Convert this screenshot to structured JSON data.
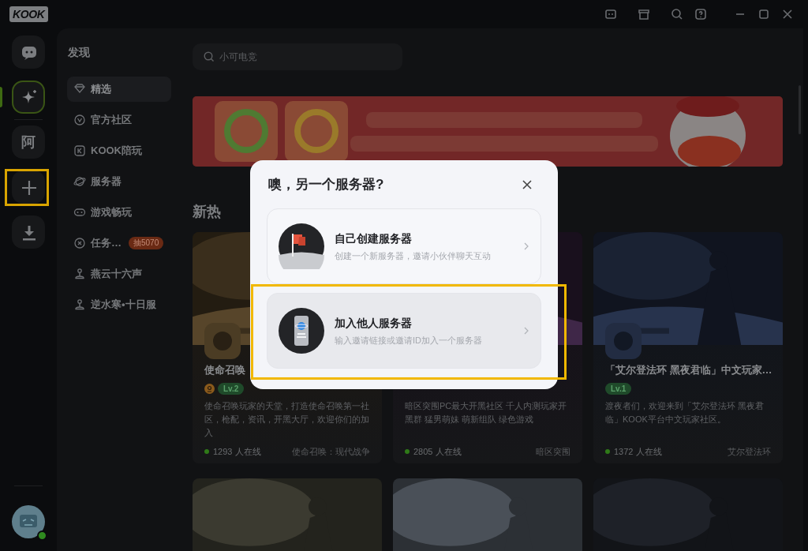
{
  "app": {
    "logo": "KOOK"
  },
  "rail": [
    {
      "kind": "dm",
      "selected": false,
      "highlighted": false
    },
    {
      "kind": "discover",
      "selected": true,
      "highlighted": false
    },
    {
      "kind": "server",
      "label": "阿",
      "selected": false,
      "highlighted": false
    },
    {
      "kind": "add",
      "selected": false,
      "highlighted": true
    },
    {
      "kind": "download",
      "selected": false,
      "highlighted": false
    }
  ],
  "user": {
    "online": true
  },
  "discover": {
    "title": "发现",
    "items": [
      {
        "label": "精选",
        "selected": true
      },
      {
        "label": "官方社区",
        "selected": false
      },
      {
        "label": "KOOK陪玩",
        "selected": false
      },
      {
        "label": "服务器",
        "selected": false
      },
      {
        "label": "游戏畅玩",
        "selected": false
      },
      {
        "label": "任务…",
        "selected": false,
        "badge": "抽5070"
      },
      {
        "label": "燕云十六声",
        "selected": false
      },
      {
        "label": "逆水寒•十日服",
        "selected": false
      }
    ]
  },
  "search": {
    "placeholder": "小可电竞"
  },
  "section": {
    "title": "新热"
  },
  "cards": [
    {
      "title": "使命召唤",
      "owner_badge": true,
      "level": "Lv.2",
      "description": "使命召唤玩家的天堂，打造使命召唤第一社区，枪配，资讯，开黑大厅，欢迎你们的加入",
      "online": "1293 人在线",
      "game": "使命召唤：现代战争"
    },
    {
      "description": "暗区突围PC最大开黑社区 千人内测玩家开黑群 猛男萌妹 萌新组队 绿色游戏",
      "online": "2805 人在线",
      "game": "暗区突围"
    },
    {
      "title": "「艾尔登法环 黑夜君临」中文玩家…",
      "owner_badge": false,
      "level": "Lv.1",
      "description": "渡夜者们，欢迎来到「艾尔登法环 黑夜君临」KOOK平台中文玩家社区。",
      "online": "1372 人在线",
      "game": "艾尔登法环"
    }
  ],
  "dialog": {
    "title": "噢，另一个服务器?",
    "options": [
      {
        "kind": "create",
        "title": "自己创建服务器",
        "subtitle": "创建一个新服务器，邀请小伙伴聊天互动",
        "hovered": false,
        "highlighted": false
      },
      {
        "kind": "join",
        "title": "加入他人服务器",
        "subtitle": "输入邀请链接或邀请ID加入一个服务器",
        "hovered": true,
        "highlighted": true
      }
    ]
  }
}
